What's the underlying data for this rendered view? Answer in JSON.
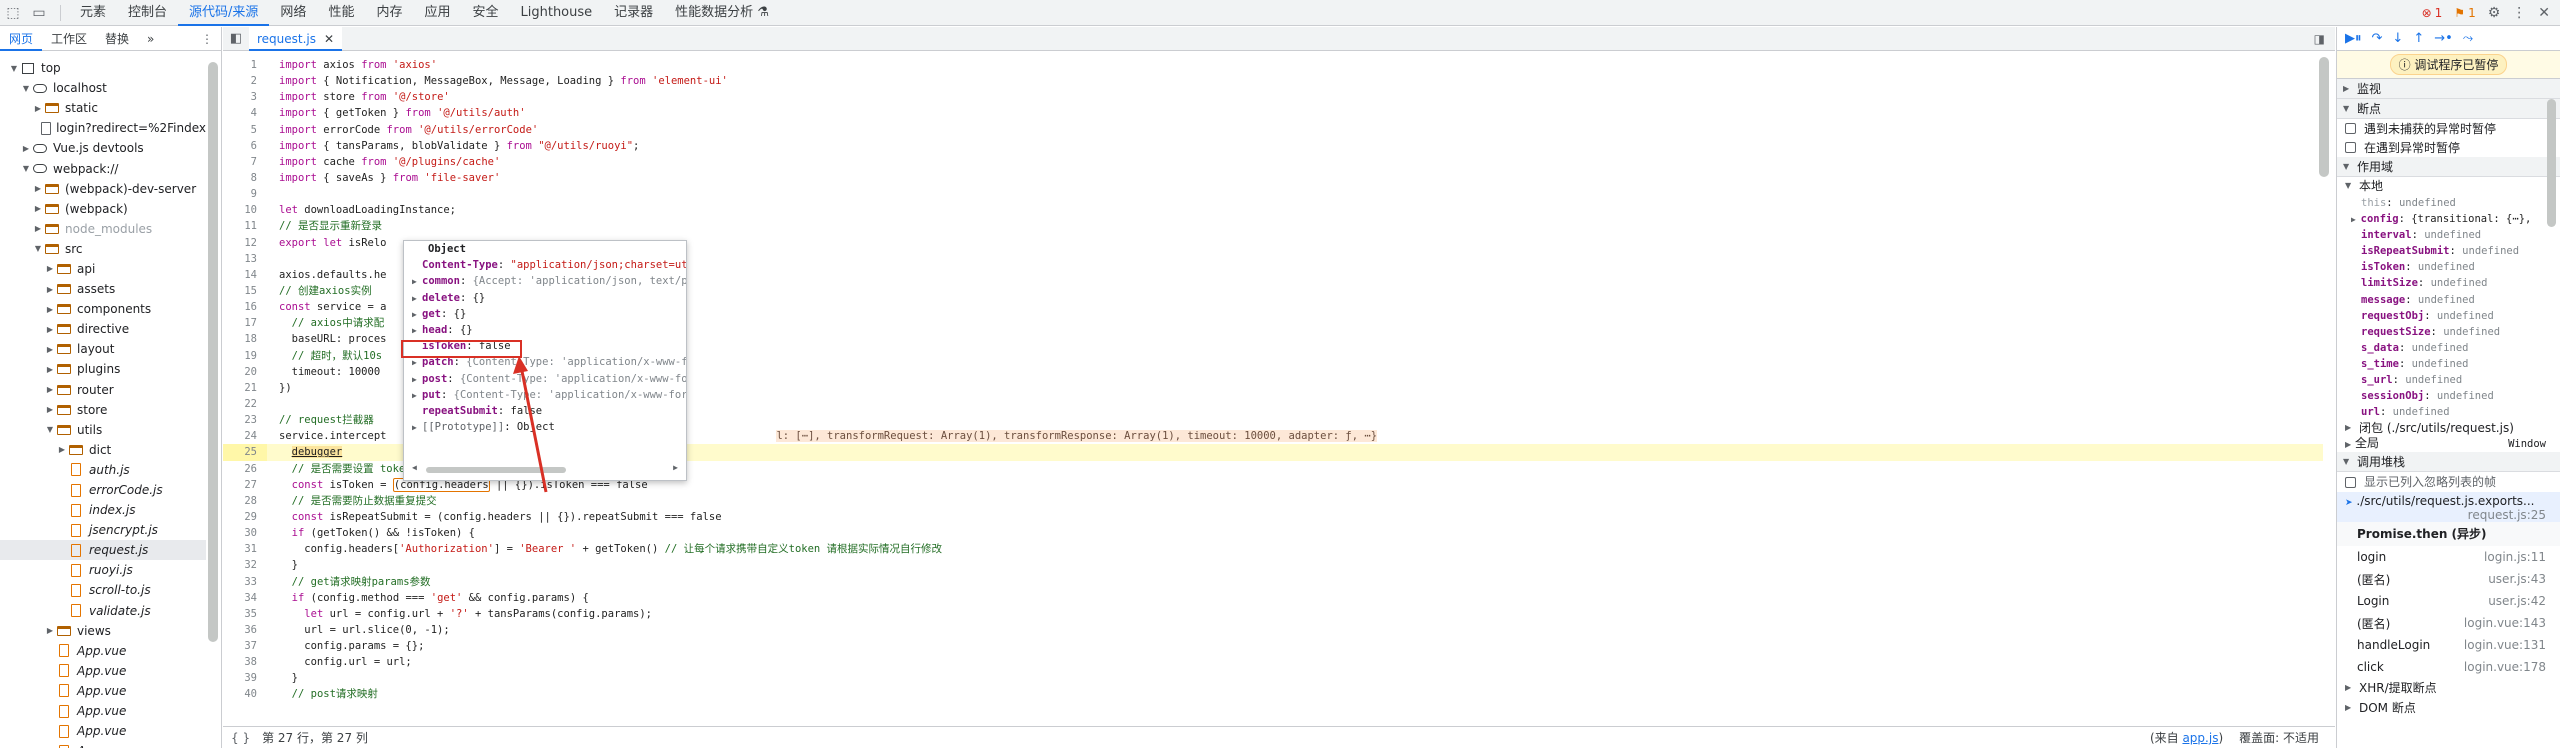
{
  "topbar": {
    "tabs": [
      "元素",
      "控制台",
      "源代码/来源",
      "网络",
      "性能",
      "内存",
      "应用",
      "安全",
      "Lighthouse",
      "记录器",
      "性能数据分析 ⚗"
    ],
    "active_tab": "源代码/来源",
    "errors": "1",
    "warnings": "1"
  },
  "navigator": {
    "tabs": [
      "网页",
      "工作区",
      "替换",
      "»"
    ],
    "tree": [
      {
        "label": "top",
        "indent": 0,
        "arrow": "▼",
        "icon": "top"
      },
      {
        "label": "localhost",
        "indent": 1,
        "arrow": "▼",
        "icon": "cloud"
      },
      {
        "label": "static",
        "indent": 2,
        "arrow": "▶",
        "icon": "folder"
      },
      {
        "label": "login?redirect=%2Findex",
        "indent": 2,
        "arrow": "",
        "icon": "doc"
      },
      {
        "label": "Vue.js devtools",
        "indent": 1,
        "arrow": "▶",
        "icon": "cloud"
      },
      {
        "label": "webpack://",
        "indent": 1,
        "arrow": "▼",
        "icon": "cloud"
      },
      {
        "label": "(webpack)-dev-server",
        "indent": 2,
        "arrow": "▶",
        "icon": "folder"
      },
      {
        "label": "(webpack)",
        "indent": 2,
        "arrow": "▶",
        "icon": "folder"
      },
      {
        "label": "node_modules",
        "indent": 2,
        "arrow": "▶",
        "icon": "folder",
        "dim": true
      },
      {
        "label": "src",
        "indent": 2,
        "arrow": "▼",
        "icon": "folder"
      },
      {
        "label": "api",
        "indent": 3,
        "arrow": "▶",
        "icon": "folder"
      },
      {
        "label": "assets",
        "indent": 3,
        "arrow": "▶",
        "icon": "folder"
      },
      {
        "label": "components",
        "indent": 3,
        "arrow": "▶",
        "icon": "folder"
      },
      {
        "label": "directive",
        "indent": 3,
        "arrow": "▶",
        "icon": "folder"
      },
      {
        "label": "layout",
        "indent": 3,
        "arrow": "▶",
        "icon": "folder"
      },
      {
        "label": "plugins",
        "indent": 3,
        "arrow": "▶",
        "icon": "folder"
      },
      {
        "label": "router",
        "indent": 3,
        "arrow": "▶",
        "icon": "folder"
      },
      {
        "label": "store",
        "indent": 3,
        "arrow": "▶",
        "icon": "folder"
      },
      {
        "label": "utils",
        "indent": 3,
        "arrow": "▼",
        "icon": "folder"
      },
      {
        "label": "dict",
        "indent": 4,
        "arrow": "▶",
        "icon": "folder"
      },
      {
        "label": "auth.js",
        "indent": 4,
        "arrow": "",
        "icon": "file",
        "italic": true
      },
      {
        "label": "errorCode.js",
        "indent": 4,
        "arrow": "",
        "icon": "file",
        "italic": true
      },
      {
        "label": "index.js",
        "indent": 4,
        "arrow": "",
        "icon": "file",
        "italic": true
      },
      {
        "label": "jsencrypt.js",
        "indent": 4,
        "arrow": "",
        "icon": "file",
        "italic": true
      },
      {
        "label": "request.js",
        "indent": 4,
        "arrow": "",
        "icon": "file",
        "italic": true,
        "selected": true
      },
      {
        "label": "ruoyi.js",
        "indent": 4,
        "arrow": "",
        "icon": "file",
        "italic": true
      },
      {
        "label": "scroll-to.js",
        "indent": 4,
        "arrow": "",
        "icon": "file",
        "italic": true
      },
      {
        "label": "validate.js",
        "indent": 4,
        "arrow": "",
        "icon": "file",
        "italic": true
      },
      {
        "label": "views",
        "indent": 3,
        "arrow": "▶",
        "icon": "folder"
      },
      {
        "label": "App.vue",
        "indent": 3,
        "arrow": "",
        "icon": "file",
        "italic": true
      },
      {
        "label": "App.vue",
        "indent": 3,
        "arrow": "",
        "icon": "file",
        "italic": true
      },
      {
        "label": "App.vue",
        "indent": 3,
        "arrow": "",
        "icon": "file",
        "italic": true
      },
      {
        "label": "App.vue",
        "indent": 3,
        "arrow": "",
        "icon": "file",
        "italic": true
      },
      {
        "label": "App.vue",
        "indent": 3,
        "arrow": "",
        "icon": "file",
        "italic": true
      },
      {
        "label": "App.vue",
        "indent": 3,
        "arrow": "",
        "icon": "file",
        "italic": true
      }
    ]
  },
  "editor": {
    "file_tab": "request.js",
    "lines": [
      "import axios from 'axios'",
      "import { Notification, MessageBox, Message, Loading } from 'element-ui'",
      "import store from '@/store'",
      "import { getToken } from '@/utils/auth'",
      "import errorCode from '@/utils/errorCode'",
      "import { tansParams, blobValidate } from \"@/utils/ruoyi\";",
      "import cache from '@/plugins/cache'",
      "import { saveAs } from 'file-saver'",
      "",
      "let downloadLoadingInstance;",
      "// 是否显示重新登录",
      "export let isRelo",
      "",
      "axios.defaults.he",
      "// 创建axios实例",
      "const service = a",
      "  // axios中请求配",
      "  baseURL: proces",
      "  // 超时，默认10s",
      "  timeout: 10000",
      "})",
      "",
      "// request拦截器",
      "service.intercept",
      "  debugger",
      "  // 是否需要设置 token",
      "  const isToken = (config.headers || {}).isToken === false",
      "  // 是否需要防止数据重复提交",
      "  const isRepeatSubmit = (config.headers || {}).repeatSubmit === false",
      "  if (getToken() && !isToken) {",
      "    config.headers['Authorization'] = 'Bearer ' + getToken() // 让每个请求携带自定义token 请根据实际情况自行修改",
      "  }",
      "  // get请求映射params参数",
      "  if (config.method === 'get' && config.params) {",
      "    let url = config.url + '?' + tansParams(config.params);",
      "    url = url.slice(0, -1);",
      "    config.params = {};",
      "    config.url = url;",
      "  }",
      "  // post请求映射"
    ],
    "inline_value_24": "l: [⋯], transformRequest: Array(1), transformResponse: Array(1), timeout: 10000, adapter: ƒ, ⋯}",
    "highlight_line": 25,
    "status_position": "第 27 行，第 27 列",
    "status_from_label": "(来自",
    "status_from_file": "app.js",
    "status_from_close": ")",
    "status_coverage": "覆盖面: 不适用"
  },
  "popover": {
    "title": "Object",
    "rows": [
      {
        "key": "Content-Type",
        "value": "\"application/json;charset=utf",
        "kind": "string",
        "arrow": ""
      },
      {
        "key": "common",
        "value": "{Accept: 'application/json, text/plain, */*'",
        "kind": "gray",
        "arrow": "▶"
      },
      {
        "key": "delete",
        "value": "{}",
        "kind": "plain",
        "arrow": "▶"
      },
      {
        "key": "get",
        "value": "{}",
        "kind": "plain",
        "arrow": "▶"
      },
      {
        "key": "head",
        "value": "{}",
        "kind": "plain",
        "arrow": "▶"
      },
      {
        "key": "isToken",
        "value": "false",
        "kind": "plain",
        "arrow": ""
      },
      {
        "key": "patch",
        "value": "{Content-Type: 'application/x-www-form",
        "kind": "gray",
        "arrow": "▶"
      },
      {
        "key": "post",
        "value": "{Content-Type: 'application/x-www-form",
        "kind": "gray",
        "arrow": "▶"
      },
      {
        "key": "put",
        "value": "{Content-Type: 'application/x-www-form-",
        "kind": "gray",
        "arrow": "▶"
      },
      {
        "key": "repeatSubmit",
        "value": "false",
        "kind": "plain",
        "arrow": ""
      },
      {
        "key": "[[Prototype]]",
        "value": "Object",
        "kind": "proto",
        "arrow": "▶"
      }
    ]
  },
  "debugger": {
    "paused_label": "调试程序已暂停",
    "sections": {
      "watch": "监视",
      "breakpoints": "断点",
      "pause_uncaught": "遇到未捕获的异常时暂停",
      "pause_caught": "在遇到异常时暂停",
      "scope": "作用域",
      "local": "本地",
      "closure": "闭包 (./src/utils/request.js)",
      "global": "全局",
      "global_value": "Window",
      "callstack": "调用堆栈",
      "show_ignored": "显示已列入忽略列表的帧",
      "xhr": "XHR/提取断点",
      "dom": "DOM 断点"
    },
    "scope_vars": [
      {
        "name": "this",
        "value": "undefined",
        "dim": true
      },
      {
        "name": "config",
        "value": "{transitional: {⋯},",
        "arrow": "▶"
      },
      {
        "name": "interval",
        "value": "undefined"
      },
      {
        "name": "isRepeatSubmit",
        "value": "undefined"
      },
      {
        "name": "isToken",
        "value": "undefined"
      },
      {
        "name": "limitSize",
        "value": "undefined"
      },
      {
        "name": "message",
        "value": "undefined"
      },
      {
        "name": "requestObj",
        "value": "undefined"
      },
      {
        "name": "requestSize",
        "value": "undefined"
      },
      {
        "name": "s_data",
        "value": "undefined"
      },
      {
        "name": "s_time",
        "value": "undefined"
      },
      {
        "name": "s_url",
        "value": "undefined"
      },
      {
        "name": "sessionObj",
        "value": "undefined"
      },
      {
        "name": "url",
        "value": "undefined"
      }
    ],
    "current_frame": {
      "name": "./src/utils/request.js.exports...",
      "loc": "request.js:25"
    },
    "async_label": "Promise.then (异步)",
    "frames": [
      {
        "name": "login",
        "loc": "login.js:11"
      },
      {
        "name": "(匿名)",
        "loc": "user.js:43"
      },
      {
        "name": "Login",
        "loc": "user.js:42"
      },
      {
        "name": "(匿名)",
        "loc": "login.vue:143"
      },
      {
        "name": "handleLogin",
        "loc": "login.vue:131"
      },
      {
        "name": "click",
        "loc": "login.vue:178"
      }
    ]
  }
}
